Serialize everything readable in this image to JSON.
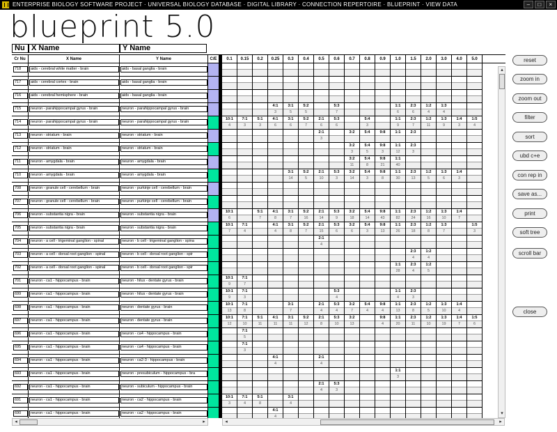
{
  "titlebar": {
    "path": "ENTERPRISE BIOLOGY SOFTWARE PROJECT  ·  UNIVERSAL BIOLOGY DATABASE  ·  DIGITAL LIBRARY  ·  CONNECTION REPERTOIRE  ·  BLUEPRINT  ·  VIEW DATA"
  },
  "app": {
    "title": "blueprint 5.0"
  },
  "column_labels": {
    "nu": "Nu",
    "xname": "X Name",
    "yname": "Y Name"
  },
  "grid": {
    "headers": {
      "crnu": "Cr Nu",
      "xname": "X Name",
      "yname": "Y Name",
      "ce": "C/E"
    },
    "value_columns": [
      "0.1",
      "0.15",
      "0.2",
      "0.25",
      "0.3",
      "0.4",
      "0.5",
      "0.6",
      "0.7",
      "0.8",
      "0.9",
      "1.0",
      "1.5",
      "2.0",
      "3.0",
      "4.0",
      "5.0"
    ],
    "ce_color_teal": "#00e69e",
    "ce_color_purple": "#b3b3f2",
    "rows": [
      {
        "nu": "718",
        "x": "aids - cerebral white matter - brain",
        "y": "aids - basal ganglia - brain",
        "ce": "purple",
        "vals": {}
      },
      {
        "nu": "717",
        "x": "aids - cerebral cortex - brain",
        "y": "aids - basal ganglia - brain",
        "ce": "purple",
        "vals": {}
      },
      {
        "nu": "716",
        "x": "aids - cerebral hemisphere - brain",
        "y": "aids - basal ganglia - brain",
        "ce": "purple",
        "vals": {}
      },
      {
        "nu": "715",
        "x": "neuron - parahippocampal gyrus - brain",
        "y": "neuron - parahippocampal gyrus - brain",
        "ce": "purple",
        "vals": {
          "3": [
            "4:1",
            "3"
          ],
          "4": [
            "3:1",
            "5"
          ],
          "5": [
            "5:2",
            "5"
          ],
          "7": [
            "5:3",
            "7"
          ],
          "11": [
            "1:1",
            "6"
          ],
          "12": [
            "2:3",
            "6"
          ],
          "13": [
            "1:2",
            "4"
          ],
          "14": [
            "1:3",
            "4"
          ]
        }
      },
      {
        "nu": "714",
        "x": "neuron - parahippocampal gyrus - brain",
        "y": "neuron - parahippocampal gyrus - brain",
        "ce": "teal",
        "vals": {
          "0": [
            "10:1",
            "4"
          ],
          "1": [
            "7:1",
            "3"
          ],
          "2": [
            "5:1",
            "3"
          ],
          "3": [
            "4:1",
            "6"
          ],
          "4": [
            "3:1",
            "6"
          ],
          "5": [
            "5:2",
            "7"
          ],
          "6": [
            "2:1",
            "6"
          ],
          "7": [
            "5:3",
            "6"
          ],
          "9": [
            "5:4",
            "3"
          ],
          "11": [
            "1:1",
            "9"
          ],
          "12": [
            "2:3",
            "7"
          ],
          "13": [
            "1:2",
            "11"
          ],
          "14": [
            "1:3",
            "9"
          ],
          "15": [
            "1:4",
            "3"
          ],
          "16": [
            "1:5",
            "4"
          ]
        }
      },
      {
        "nu": "713",
        "x": "neuron - striatum - brain",
        "y": "neuron - striatum - brain",
        "ce": "purple",
        "vals": {
          "6": [
            "2:1",
            "3"
          ],
          "8": [
            "3:2",
            ""
          ],
          "9": [
            "5:4",
            ""
          ],
          "10": [
            "9:8",
            ""
          ],
          "11": [
            "1:1",
            ""
          ],
          "12": [
            "2:3",
            ""
          ]
        }
      },
      {
        "nu": "712",
        "x": "neuron - striatum - brain",
        "y": "neuron - striatum - brain",
        "ce": "teal",
        "vals": {
          "8": [
            "3:2",
            "3"
          ],
          "9": [
            "5:4",
            "5"
          ],
          "10": [
            "9:8",
            "3"
          ],
          "11": [
            "1:1",
            "12"
          ],
          "12": [
            "2:3",
            "3"
          ]
        }
      },
      {
        "nu": "711",
        "x": "neuron - amygdala - brain",
        "y": "neuron - amygdala - brain",
        "ce": "purple",
        "vals": {
          "8": [
            "3:2",
            "11"
          ],
          "9": [
            "5:4",
            "8"
          ],
          "10": [
            "9:8",
            "21"
          ],
          "11": [
            "1:1",
            "40"
          ]
        }
      },
      {
        "nu": "710",
        "x": "neuron - amygdala - brain",
        "y": "neuron - amygdala - brain",
        "ce": "teal",
        "vals": {
          "4": [
            "3:1",
            "14"
          ],
          "5": [
            "5:2",
            "5"
          ],
          "6": [
            "2:1",
            "10"
          ],
          "7": [
            "5:3",
            "3"
          ],
          "8": [
            "3:2",
            "14"
          ],
          "9": [
            "5:4",
            "3"
          ],
          "10": [
            "9:8",
            "8"
          ],
          "11": [
            "1:1",
            "30"
          ],
          "12": [
            "2:3",
            "13"
          ],
          "13": [
            "1:2",
            "5"
          ],
          "14": [
            "1:3",
            "6"
          ],
          "15": [
            "1:4",
            "3"
          ]
        }
      },
      {
        "nu": "708",
        "x": "neuron - granule cell - cerebellum - brain",
        "y": "neuron - purkinje cell - cerebellum - brain",
        "ce": "purple",
        "vals": {}
      },
      {
        "nu": "707",
        "x": "neuron - granule cell - cerebellum - brain",
        "y": "neuron - purkinje cell - cerebellum - brain",
        "ce": "teal",
        "vals": {}
      },
      {
        "nu": "706",
        "x": "neuron - substantia nigra - brain",
        "y": "neuron - substantia nigra - brain",
        "ce": "purple",
        "vals": {
          "0": [
            "10:1",
            "6"
          ],
          "2": [
            "5:1",
            "7"
          ],
          "3": [
            "4:1",
            "8"
          ],
          "4": [
            "3:1",
            "7"
          ],
          "5": [
            "5:2",
            "16"
          ],
          "6": [
            "2:1",
            "14"
          ],
          "7": [
            "5:3",
            "9"
          ],
          "8": [
            "3:2",
            "18"
          ],
          "9": [
            "5:4",
            "14"
          ],
          "10": [
            "9:8",
            "43"
          ],
          "11": [
            "1:1",
            "82"
          ],
          "12": [
            "2:3",
            "24"
          ],
          "13": [
            "1:2",
            "16"
          ],
          "14": [
            "1:3",
            "10"
          ],
          "15": [
            "1:4",
            "7"
          ]
        }
      },
      {
        "nu": "705",
        "x": "neuron - substantia nigra - brain",
        "y": "neuron - substantia nigra - brain",
        "ce": "teal",
        "vals": {
          "0": [
            "10:1",
            "7"
          ],
          "1": [
            "7:1",
            "4"
          ],
          "3": [
            "4:1",
            "4"
          ],
          "4": [
            "3:1",
            "8"
          ],
          "5": [
            "5:2",
            "7"
          ],
          "6": [
            "2:1",
            "15"
          ],
          "7": [
            "5:3",
            "6"
          ],
          "8": [
            "3:2",
            "6"
          ],
          "9": [
            "5:4",
            "3"
          ],
          "10": [
            "9:8",
            "13"
          ],
          "11": [
            "1:1",
            "26"
          ],
          "12": [
            "2:3",
            "18"
          ],
          "13": [
            "1:2",
            "8"
          ],
          "14": [
            "1:3",
            "7"
          ],
          "16": [
            "1:5",
            "3"
          ]
        }
      },
      {
        "nu": "704",
        "x": "neuron - a cell - trigeminal ganglion - spinal",
        "y": "neuron - b cell - trigeminal ganglion - spina",
        "ce": "teal",
        "vals": {
          "6": [
            "2:1",
            "4"
          ]
        }
      },
      {
        "nu": "703",
        "x": "neuron - a cell - dorsal root ganglion - spinal",
        "y": "neuron - b cell - dorsal root ganglion - spir",
        "ce": "teal",
        "vals": {
          "12": [
            "2:3",
            "4"
          ],
          "13": [
            "1:2",
            "4"
          ]
        }
      },
      {
        "nu": "702",
        "x": "neuron - a cell - dorsal root ganglion - spinal",
        "y": "neuron - b cell - dorsal root ganglion - spir",
        "ce": "teal",
        "vals": {
          "11": [
            "1:1",
            "28"
          ],
          "12": [
            "2:3",
            "4"
          ],
          "13": [
            "1:2",
            "5"
          ]
        }
      },
      {
        "nu": "701",
        "x": "neuron - ca1 - hippocampus - brain",
        "y": "neuron - hilus - dentate gyrus - brain",
        "ce": "teal",
        "vals": {
          "0": [
            "10:1",
            "9"
          ],
          "1": [
            "7:1",
            "7"
          ]
        }
      },
      {
        "nu": "699",
        "x": "neuron - ca1 - hippocampus - brain",
        "y": "neuron - hilus - dentate gyrus - brain",
        "ce": "teal",
        "vals": {
          "0": [
            "10:1",
            "9"
          ],
          "1": [
            "7:1",
            "3"
          ],
          "7": [
            "5:3",
            "4"
          ],
          "11": [
            "1:1",
            "4"
          ],
          "12": [
            "2:3",
            "3"
          ]
        }
      },
      {
        "nu": "698",
        "x": "neuron - ca1 - hippocampus - brain",
        "y": "neuron - dentate gyrus - brain",
        "ce": "teal",
        "vals": {
          "0": [
            "10:1",
            "13"
          ],
          "1": [
            "7:1",
            "8"
          ],
          "4": [
            "3:1",
            "7"
          ],
          "6": [
            "2:1",
            "4"
          ],
          "7": [
            "5:3",
            "4"
          ],
          "8": [
            "3:2",
            "7"
          ],
          "9": [
            "5:4",
            "4"
          ],
          "10": [
            "9:8",
            "4"
          ],
          "11": [
            "1:1",
            "13"
          ],
          "12": [
            "2:3",
            "8"
          ],
          "13": [
            "1:2",
            "5"
          ],
          "14": [
            "1:3",
            "10"
          ],
          "15": [
            "1:4",
            "4"
          ]
        }
      },
      {
        "nu": "697",
        "x": "neuron - ca1 - hippocampus - brain",
        "y": "neuron - dentate gyrus - brain",
        "ce": "teal",
        "vals": {
          "0": [
            "10:1",
            "12"
          ],
          "1": [
            "7:1",
            "10"
          ],
          "2": [
            "5:1",
            "11"
          ],
          "3": [
            "4:1",
            "11"
          ],
          "4": [
            "3:1",
            "11"
          ],
          "5": [
            "5:2",
            "12"
          ],
          "6": [
            "2:1",
            "8"
          ],
          "7": [
            "5:3",
            "10"
          ],
          "8": [
            "3:2",
            "13"
          ],
          "10": [
            "9:8",
            "4"
          ],
          "11": [
            "1:1",
            "20"
          ],
          "12": [
            "2:3",
            "11"
          ],
          "13": [
            "1:2",
            "10"
          ],
          "14": [
            "1:3",
            "19"
          ],
          "15": [
            "1:4",
            "7"
          ],
          "16": [
            "1:5",
            "6"
          ]
        }
      },
      {
        "nu": "696",
        "x": "neuron - ca1 - hippocampus - brain",
        "y": "neuron - ca4 - hippocampus - brain",
        "ce": "teal",
        "vals": {
          "1": [
            "7:1",
            "5"
          ]
        }
      },
      {
        "nu": "695",
        "x": "neuron - ca1 - hippocampus - brain",
        "y": "neuron - ca4 - hippocampus - brain",
        "ce": "teal",
        "vals": {
          "1": [
            "7:1",
            "3"
          ]
        }
      },
      {
        "nu": "694",
        "x": "neuron - ca1 - hippocampus - brain",
        "y": "neuron - ca2-3 - hippocampus - brain",
        "ce": "teal",
        "vals": {
          "3": [
            "4:1",
            "4"
          ],
          "6": [
            "2:1",
            "4"
          ]
        }
      },
      {
        "nu": "693",
        "x": "neuron - ca1 - hippocampus - brain",
        "y": "neuron - presubiculum - hippocampus - bra",
        "ce": "teal",
        "vals": {
          "11": [
            "1:1",
            "3"
          ]
        }
      },
      {
        "nu": "692",
        "x": "neuron - ca1 - hippocampus - brain",
        "y": "neuron - subiculum - hippocampus - brain",
        "ce": "teal",
        "vals": {
          "6": [
            "2:1",
            "4"
          ],
          "7": [
            "5:3",
            "3"
          ]
        }
      },
      {
        "nu": "691",
        "x": "neuron - ca1 - hippocampus - brain",
        "y": "neuron - ca2 - hippocampus - brain",
        "ce": "teal",
        "vals": {
          "0": [
            "10:1",
            "3"
          ],
          "1": [
            "7:1",
            "4"
          ],
          "2": [
            "5:1",
            "8"
          ],
          "4": [
            "3:1",
            "4"
          ]
        }
      },
      {
        "nu": "690",
        "x": "neuron - ca1 - hippocampus - brain",
        "y": "neuron - ca2 - hippocampus - brain",
        "ce": "teal",
        "vals": {
          "3": [
            "4:1",
            "4"
          ]
        }
      }
    ]
  },
  "buttons": [
    {
      "id": "reset",
      "label": "reset"
    },
    {
      "id": "zoom-in",
      "label": "zoom in"
    },
    {
      "id": "zoom-out",
      "label": "zoom out"
    },
    {
      "id": "filter",
      "label": "filter"
    },
    {
      "id": "sort",
      "label": "sort"
    },
    {
      "id": "ubd-ce",
      "label": "ubd c+e"
    },
    {
      "id": "con-rep-in",
      "label": "con rep in"
    },
    {
      "id": "save-as",
      "label": "save as..."
    },
    {
      "id": "print",
      "label": "print"
    },
    {
      "id": "soft-tree",
      "label": "soft tree"
    },
    {
      "id": "scroll-bar",
      "label": "scroll bar"
    },
    {
      "id": "close",
      "label": "close"
    }
  ]
}
